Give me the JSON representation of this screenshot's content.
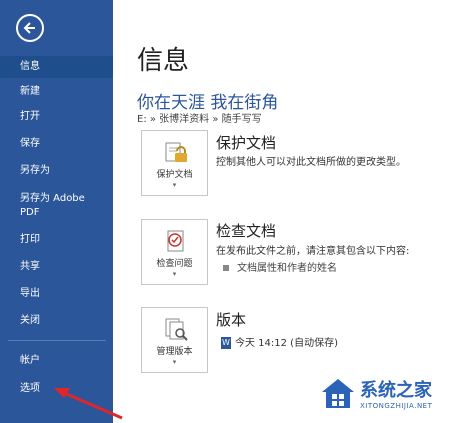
{
  "sidebar": {
    "items": [
      {
        "label": "信息",
        "selected": true
      },
      {
        "label": "新建"
      },
      {
        "label": "打开"
      },
      {
        "label": "保存"
      },
      {
        "label": "另存为"
      },
      {
        "label_line1": "另存为 Adobe",
        "label_line2": "PDF"
      },
      {
        "label": "打印"
      },
      {
        "label": "共享"
      },
      {
        "label": "导出"
      },
      {
        "label": "关闭"
      },
      {
        "label": "帐户"
      },
      {
        "label": "选项"
      }
    ],
    "back_icon": "back-arrow-icon",
    "colors": {
      "background": "#2b579a",
      "selected": "#1e4e8c",
      "text": "#ffffff"
    }
  },
  "main": {
    "title": "信息",
    "doc_name": "你在天涯 我在街角",
    "doc_path": "E: » 张博洋资料 » 随手写写",
    "sections": [
      {
        "tile_label": "保护文档",
        "icon": "lock-key-icon",
        "title": "保护文档",
        "description": "控制其他人可以对此文档所做的更改类型。"
      },
      {
        "tile_label": "检查问题",
        "icon": "inspect-document-icon",
        "title": "检查文档",
        "description": "在发布此文件之前，请注意其包含以下内容:",
        "bullets": [
          "文档属性和作者的姓名"
        ]
      },
      {
        "tile_label": "管理版本",
        "icon": "manage-versions-icon",
        "title": "版本",
        "versions": [
          "今天 14:12 (自动保存)"
        ]
      }
    ],
    "caret": "▾",
    "accent_color": "#2b579a"
  },
  "annotation": {
    "arrow_color": "#e0262b"
  },
  "watermark": {
    "title": "系统之家",
    "subtitle": "XITONGZHIJIA.NET",
    "color": "#2a63b8"
  }
}
